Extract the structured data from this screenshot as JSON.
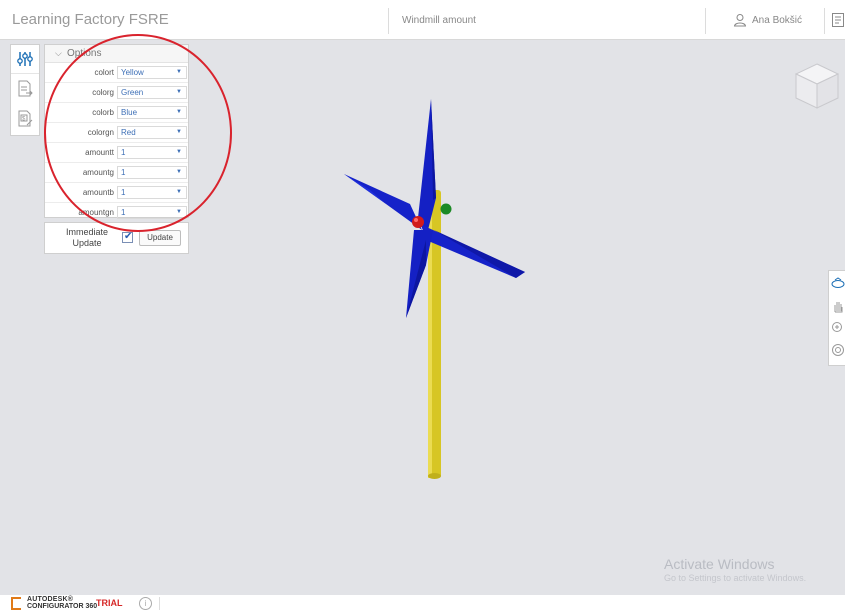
{
  "header": {
    "app_title": "Learning Factory FSRE",
    "model_title": "Windmill amount",
    "user_name": "Ana Bokšić",
    "user_icon": "user-icon",
    "doc_icon": "document-icon"
  },
  "side_toolbar": {
    "items": [
      {
        "icon": "parameters-sliders-icon",
        "active": true
      },
      {
        "icon": "document-export-icon",
        "active": false
      },
      {
        "icon": "price-quote-icon",
        "active": false
      }
    ]
  },
  "options": {
    "title": "Options",
    "params": [
      {
        "label": "colort",
        "value": "Yellow"
      },
      {
        "label": "colorg",
        "value": "Green"
      },
      {
        "label": "colorb",
        "value": "Blue"
      },
      {
        "label": "colorgn",
        "value": "Red"
      },
      {
        "label": "amountt",
        "value": "1"
      },
      {
        "label": "amountg",
        "value": "1"
      },
      {
        "label": "amountb",
        "value": "1"
      },
      {
        "label": "amountgn",
        "value": "1"
      }
    ]
  },
  "update": {
    "immediate_label": "Immediate Update",
    "immediate_checked": true,
    "button_label": "Update"
  },
  "watermark": {
    "line1": "Activate Windows",
    "line2": "Go to Settings to activate Windows."
  },
  "footer": {
    "brand_line1": "AUTODESK®",
    "brand_line2": "CONFIGURATOR 360",
    "trial_label": "TRIAL",
    "info_icon": "ⓘ"
  },
  "colors": {
    "blade": "#1522c9",
    "tower": "#d7c624",
    "hub_red": "#d11b1b",
    "hub_green": "#1c8a26",
    "annotation": "#d9232d",
    "accent": "#3d6fb6"
  }
}
